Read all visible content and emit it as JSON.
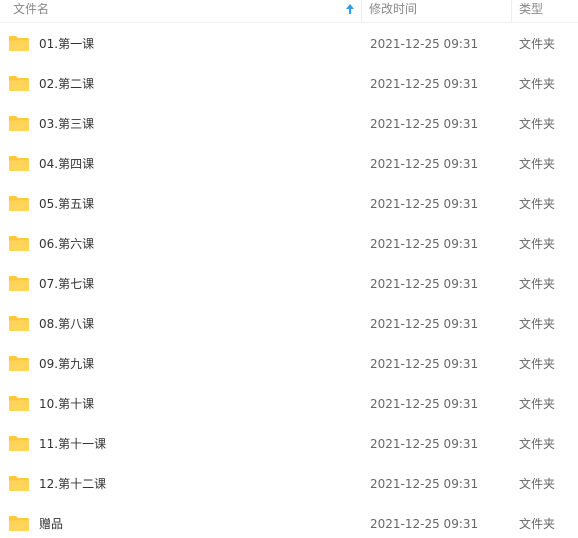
{
  "header": {
    "name_label": "文件名",
    "date_label": "修改时间",
    "type_label": "类型",
    "sort_icon": "sort-up-arrow-icon",
    "accent_color": "#2ea0e6"
  },
  "folder_color": "#ffcf3f",
  "rows": [
    {
      "name": "01.第一课",
      "date": "2021-12-25 09:31",
      "type": "文件夹"
    },
    {
      "name": "02.第二课",
      "date": "2021-12-25 09:31",
      "type": "文件夹"
    },
    {
      "name": "03.第三课",
      "date": "2021-12-25 09:31",
      "type": "文件夹"
    },
    {
      "name": "04.第四课",
      "date": "2021-12-25 09:31",
      "type": "文件夹"
    },
    {
      "name": "05.第五课",
      "date": "2021-12-25 09:31",
      "type": "文件夹"
    },
    {
      "name": "06.第六课",
      "date": "2021-12-25 09:31",
      "type": "文件夹"
    },
    {
      "name": "07.第七课",
      "date": "2021-12-25 09:31",
      "type": "文件夹"
    },
    {
      "name": "08.第八课",
      "date": "2021-12-25 09:31",
      "type": "文件夹"
    },
    {
      "name": "09.第九课",
      "date": "2021-12-25 09:31",
      "type": "文件夹"
    },
    {
      "name": "10.第十课",
      "date": "2021-12-25 09:31",
      "type": "文件夹"
    },
    {
      "name": "11.第十一课",
      "date": "2021-12-25 09:31",
      "type": "文件夹"
    },
    {
      "name": "12.第十二课",
      "date": "2021-12-25 09:31",
      "type": "文件夹"
    },
    {
      "name": "赠品",
      "date": "2021-12-25 09:31",
      "type": "文件夹"
    }
  ]
}
